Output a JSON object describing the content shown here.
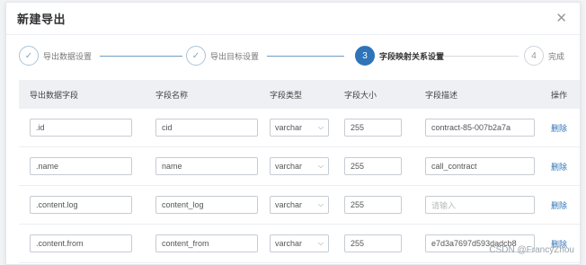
{
  "dialog": {
    "title": "新建导出",
    "close_icon": "close-icon"
  },
  "steps": [
    {
      "label": "导出数据设置",
      "state": "done",
      "number": ""
    },
    {
      "label": "导出目标设置",
      "state": "done",
      "number": ""
    },
    {
      "label": "字段映射关系设置",
      "state": "active",
      "number": "3"
    },
    {
      "label": "完成",
      "state": "todo",
      "number": "4"
    }
  ],
  "table": {
    "headers": [
      "导出数据字段",
      "字段名称",
      "字段类型",
      "字段大小",
      "字段描述",
      "操作"
    ],
    "rows": [
      {
        "source": ".id",
        "name": "cid",
        "type": "varchar",
        "size": "255",
        "desc": "contract-85-007b2a7a",
        "desc_placeholder": "",
        "action": "删除"
      },
      {
        "source": ".name",
        "name": "name",
        "type": "varchar",
        "size": "255",
        "desc": "call_contract",
        "desc_placeholder": "",
        "action": "删除"
      },
      {
        "source": ".content.log",
        "name": "content_log",
        "type": "varchar",
        "size": "255",
        "desc": "",
        "desc_placeholder": "请输入",
        "action": "删除"
      },
      {
        "source": ".content.from",
        "name": "content_from",
        "type": "varchar",
        "size": "255",
        "desc": "e7d3a7697d593dadcb8",
        "desc_placeholder": "",
        "action": "删除"
      }
    ]
  },
  "watermark": "CSDN @FrancyZhou"
}
